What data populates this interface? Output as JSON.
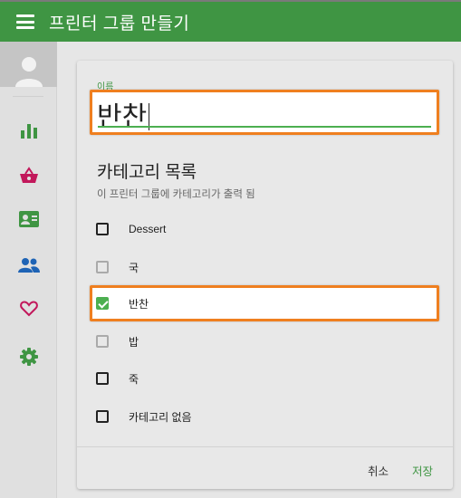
{
  "app": {
    "title": "프린터 그룹 만들기",
    "accent": "#3f9543",
    "highlight": "#ef7f1f"
  },
  "sidebar": {
    "items": [
      {
        "name": "chart-icon",
        "color": "#3f9543"
      },
      {
        "name": "basket-icon",
        "color": "#c2185b"
      },
      {
        "name": "id-card-icon",
        "color": "#3f9543"
      },
      {
        "name": "people-icon",
        "color": "#1e63b5"
      },
      {
        "name": "heart-icon",
        "color": "#c2185b"
      },
      {
        "name": "gear-icon",
        "color": "#3f9543"
      }
    ]
  },
  "form": {
    "name_label": "이름",
    "name_value": "반찬",
    "section_title": "카테고리 목록",
    "section_subtitle": "이 프린터 그룹에 카테고리가 출력 됨",
    "categories": [
      {
        "label": "Dessert",
        "checked": false,
        "disabled": false
      },
      {
        "label": "국",
        "checked": false,
        "disabled": true
      },
      {
        "label": "반찬",
        "checked": true,
        "disabled": false
      },
      {
        "label": "밥",
        "checked": false,
        "disabled": true
      },
      {
        "label": "죽",
        "checked": false,
        "disabled": false
      },
      {
        "label": "카테고리 없음",
        "checked": false,
        "disabled": false
      }
    ],
    "cancel_label": "취소",
    "save_label": "저장"
  }
}
